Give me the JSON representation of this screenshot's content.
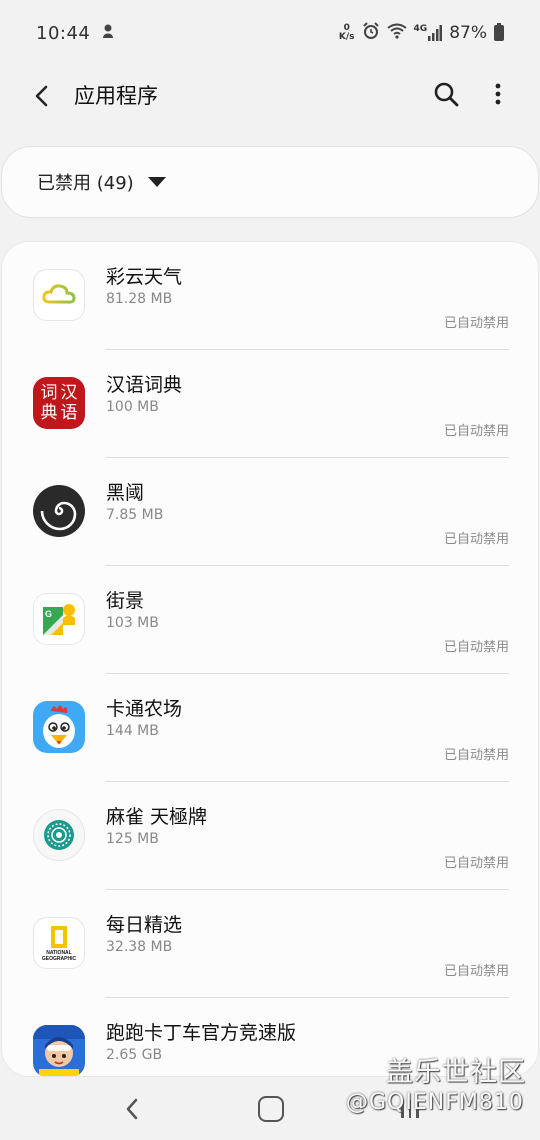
{
  "status_bar": {
    "time": "10:44",
    "net_speed_value": "0",
    "net_speed_unit": "K/s",
    "network": "4G",
    "battery": "87%"
  },
  "header": {
    "title": "应用程序"
  },
  "filter": {
    "label": "已禁用 (49)"
  },
  "apps": [
    {
      "name": "彩云天气",
      "size": "81.28 MB",
      "status": "已自动禁用",
      "icon": "caiyun-weather-icon"
    },
    {
      "name": "汉语词典",
      "size": "100 MB",
      "status": "已自动禁用",
      "icon": "chinese-dictionary-icon",
      "icon_text": [
        "词",
        "汉",
        "典",
        "语"
      ]
    },
    {
      "name": "黑阈",
      "size": "7.85 MB",
      "status": "已自动禁用",
      "icon": "heiyu-icon"
    },
    {
      "name": "街景",
      "size": "103 MB",
      "status": "已自动禁用",
      "icon": "street-view-icon"
    },
    {
      "name": "卡通农场",
      "size": "144 MB",
      "status": "已自动禁用",
      "icon": "hay-day-icon"
    },
    {
      "name": "麻雀 天極牌",
      "size": "125 MB",
      "status": "已自动禁用",
      "icon": "mahjong-icon"
    },
    {
      "name": "每日精选",
      "size": "32.38 MB",
      "status": "已自动禁用",
      "icon": "national-geographic-icon",
      "icon_text": [
        "NATIONAL",
        "GEOGRAPHIC"
      ]
    },
    {
      "name": "跑跑卡丁车官方竞速版",
      "size": "2.65 GB",
      "status": "",
      "icon": "kartrider-icon"
    }
  ],
  "watermark": {
    "line1": "盖乐世社区",
    "line2": "@GQIENFM810"
  }
}
